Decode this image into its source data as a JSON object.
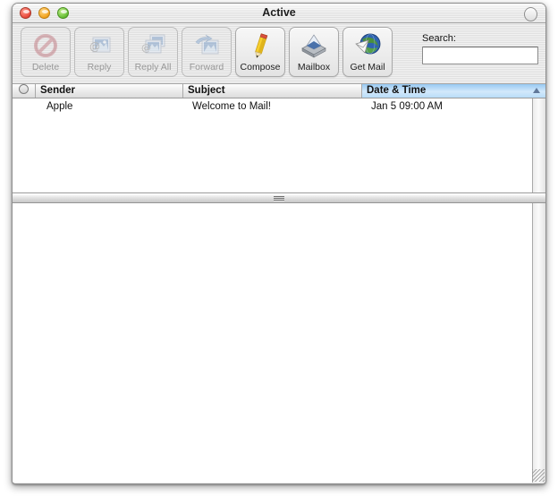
{
  "window": {
    "title": "Active",
    "traffic_lights": [
      {
        "name": "close",
        "color": "#e8483a"
      },
      {
        "name": "minimize",
        "color": "#f2a21c"
      },
      {
        "name": "zoom",
        "color": "#64bd34"
      }
    ],
    "toolbar_toggle_icon": "toolbar-pill-icon"
  },
  "toolbar": {
    "buttons": [
      {
        "label": "Delete",
        "icon": "delete-prohibition-icon",
        "enabled": false
      },
      {
        "label": "Reply",
        "icon": "reply-stamp-icon",
        "enabled": false
      },
      {
        "label": "Reply All",
        "icon": "reply-all-stamp-icon",
        "enabled": false
      },
      {
        "label": "Forward",
        "icon": "forward-arrow-stamp-icon",
        "enabled": false
      },
      {
        "label": "Compose",
        "icon": "compose-pencil-icon",
        "enabled": true
      },
      {
        "label": "Mailbox",
        "icon": "mailbox-tray-icon",
        "enabled": true
      },
      {
        "label": "Get Mail",
        "icon": "get-mail-globe-icon",
        "enabled": true
      }
    ],
    "search": {
      "label": "Search:",
      "value": "",
      "placeholder": ""
    }
  },
  "message_list": {
    "columns": [
      {
        "key": "status",
        "label": "",
        "sorted": false
      },
      {
        "key": "sender",
        "label": "Sender",
        "sorted": false
      },
      {
        "key": "subject",
        "label": "Subject",
        "sorted": false
      },
      {
        "key": "datetime",
        "label": "Date & Time",
        "sorted": true,
        "sort_direction": "ascending"
      }
    ],
    "status_header_icon": "unread-status-icon",
    "sort_indicator_icon": "sort-ascending-triangle-icon",
    "rows": [
      {
        "status": "",
        "sender": "Apple",
        "subject": "Welcome to Mail!",
        "datetime": "Jan 5  09:00 AM"
      }
    ]
  },
  "splitter": {
    "grip_icon": "splitter-grip-icon"
  },
  "message_body": {
    "content": "",
    "resize_grip_icon": "resize-grip-icon"
  },
  "colors": {
    "sorted_column_highlight": "#b9dcf8",
    "window_chrome": "#e4e4e4",
    "delete_icon": "#c9848a",
    "compose_pencil": "#f2c41c"
  }
}
